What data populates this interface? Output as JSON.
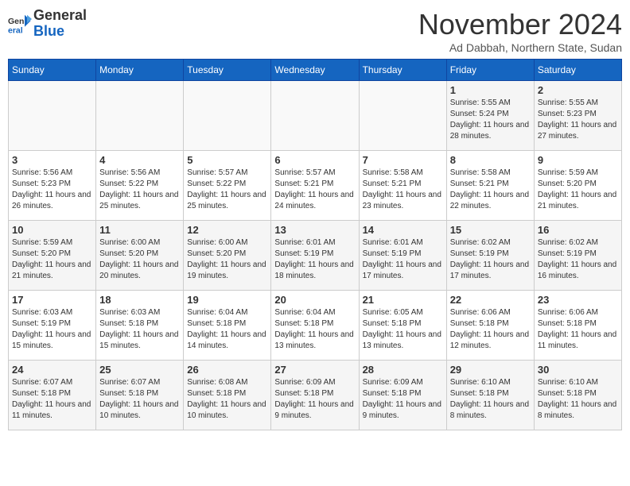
{
  "logo": {
    "general": "General",
    "blue": "Blue"
  },
  "header": {
    "title": "November 2024",
    "subtitle": "Ad Dabbah, Northern State, Sudan"
  },
  "days_of_week": [
    "Sunday",
    "Monday",
    "Tuesday",
    "Wednesday",
    "Thursday",
    "Friday",
    "Saturday"
  ],
  "weeks": [
    [
      {
        "day": "",
        "info": ""
      },
      {
        "day": "",
        "info": ""
      },
      {
        "day": "",
        "info": ""
      },
      {
        "day": "",
        "info": ""
      },
      {
        "day": "",
        "info": ""
      },
      {
        "day": "1",
        "info": "Sunrise: 5:55 AM\nSunset: 5:24 PM\nDaylight: 11 hours and 28 minutes."
      },
      {
        "day": "2",
        "info": "Sunrise: 5:55 AM\nSunset: 5:23 PM\nDaylight: 11 hours and 27 minutes."
      }
    ],
    [
      {
        "day": "3",
        "info": "Sunrise: 5:56 AM\nSunset: 5:23 PM\nDaylight: 11 hours and 26 minutes."
      },
      {
        "day": "4",
        "info": "Sunrise: 5:56 AM\nSunset: 5:22 PM\nDaylight: 11 hours and 25 minutes."
      },
      {
        "day": "5",
        "info": "Sunrise: 5:57 AM\nSunset: 5:22 PM\nDaylight: 11 hours and 25 minutes."
      },
      {
        "day": "6",
        "info": "Sunrise: 5:57 AM\nSunset: 5:21 PM\nDaylight: 11 hours and 24 minutes."
      },
      {
        "day": "7",
        "info": "Sunrise: 5:58 AM\nSunset: 5:21 PM\nDaylight: 11 hours and 23 minutes."
      },
      {
        "day": "8",
        "info": "Sunrise: 5:58 AM\nSunset: 5:21 PM\nDaylight: 11 hours and 22 minutes."
      },
      {
        "day": "9",
        "info": "Sunrise: 5:59 AM\nSunset: 5:20 PM\nDaylight: 11 hours and 21 minutes."
      }
    ],
    [
      {
        "day": "10",
        "info": "Sunrise: 5:59 AM\nSunset: 5:20 PM\nDaylight: 11 hours and 21 minutes."
      },
      {
        "day": "11",
        "info": "Sunrise: 6:00 AM\nSunset: 5:20 PM\nDaylight: 11 hours and 20 minutes."
      },
      {
        "day": "12",
        "info": "Sunrise: 6:00 AM\nSunset: 5:20 PM\nDaylight: 11 hours and 19 minutes."
      },
      {
        "day": "13",
        "info": "Sunrise: 6:01 AM\nSunset: 5:19 PM\nDaylight: 11 hours and 18 minutes."
      },
      {
        "day": "14",
        "info": "Sunrise: 6:01 AM\nSunset: 5:19 PM\nDaylight: 11 hours and 17 minutes."
      },
      {
        "day": "15",
        "info": "Sunrise: 6:02 AM\nSunset: 5:19 PM\nDaylight: 11 hours and 17 minutes."
      },
      {
        "day": "16",
        "info": "Sunrise: 6:02 AM\nSunset: 5:19 PM\nDaylight: 11 hours and 16 minutes."
      }
    ],
    [
      {
        "day": "17",
        "info": "Sunrise: 6:03 AM\nSunset: 5:19 PM\nDaylight: 11 hours and 15 minutes."
      },
      {
        "day": "18",
        "info": "Sunrise: 6:03 AM\nSunset: 5:18 PM\nDaylight: 11 hours and 15 minutes."
      },
      {
        "day": "19",
        "info": "Sunrise: 6:04 AM\nSunset: 5:18 PM\nDaylight: 11 hours and 14 minutes."
      },
      {
        "day": "20",
        "info": "Sunrise: 6:04 AM\nSunset: 5:18 PM\nDaylight: 11 hours and 13 minutes."
      },
      {
        "day": "21",
        "info": "Sunrise: 6:05 AM\nSunset: 5:18 PM\nDaylight: 11 hours and 13 minutes."
      },
      {
        "day": "22",
        "info": "Sunrise: 6:06 AM\nSunset: 5:18 PM\nDaylight: 11 hours and 12 minutes."
      },
      {
        "day": "23",
        "info": "Sunrise: 6:06 AM\nSunset: 5:18 PM\nDaylight: 11 hours and 11 minutes."
      }
    ],
    [
      {
        "day": "24",
        "info": "Sunrise: 6:07 AM\nSunset: 5:18 PM\nDaylight: 11 hours and 11 minutes."
      },
      {
        "day": "25",
        "info": "Sunrise: 6:07 AM\nSunset: 5:18 PM\nDaylight: 11 hours and 10 minutes."
      },
      {
        "day": "26",
        "info": "Sunrise: 6:08 AM\nSunset: 5:18 PM\nDaylight: 11 hours and 10 minutes."
      },
      {
        "day": "27",
        "info": "Sunrise: 6:09 AM\nSunset: 5:18 PM\nDaylight: 11 hours and 9 minutes."
      },
      {
        "day": "28",
        "info": "Sunrise: 6:09 AM\nSunset: 5:18 PM\nDaylight: 11 hours and 9 minutes."
      },
      {
        "day": "29",
        "info": "Sunrise: 6:10 AM\nSunset: 5:18 PM\nDaylight: 11 hours and 8 minutes."
      },
      {
        "day": "30",
        "info": "Sunrise: 6:10 AM\nSunset: 5:18 PM\nDaylight: 11 hours and 8 minutes."
      }
    ]
  ]
}
